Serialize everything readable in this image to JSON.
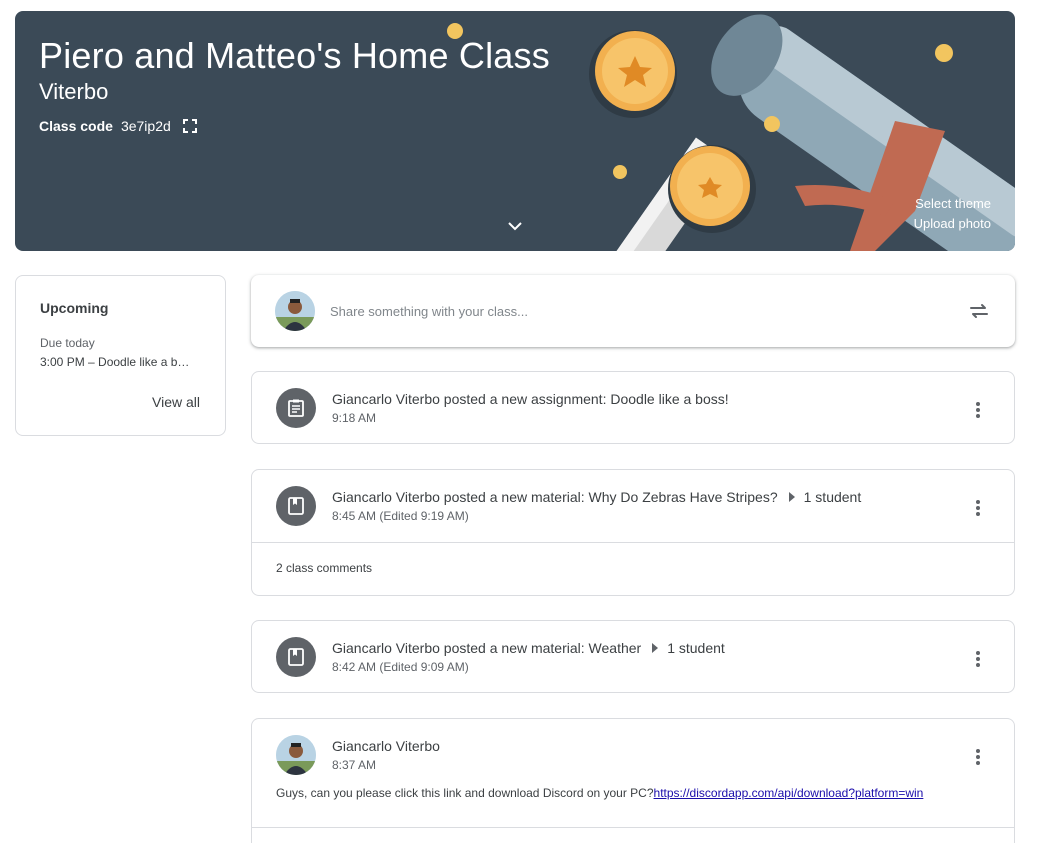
{
  "banner": {
    "title": "Piero and Matteo's Home Class",
    "subtitle": "Viterbo",
    "class_code_label": "Class code",
    "class_code": "3e7ip2d",
    "select_theme": "Select theme",
    "upload_photo": "Upload photo"
  },
  "upcoming": {
    "heading": "Upcoming",
    "due_label": "Due today",
    "item": "3:00 PM – Doodle like a b…",
    "view_all": "View all"
  },
  "share": {
    "placeholder": "Share something with your class..."
  },
  "posts": [
    {
      "title": "Giancarlo Viterbo posted a new assignment: Doodle like a boss!",
      "time": "9:18 AM"
    },
    {
      "title": "Giancarlo Viterbo posted a new material: Why Do Zebras Have Stripes?",
      "audience": "1 student",
      "time": "8:45 AM (Edited 9:19 AM)",
      "comments": "2 class comments"
    },
    {
      "title": "Giancarlo Viterbo posted a new material: Weather",
      "audience": "1 student",
      "time": "8:42 AM (Edited 9:09 AM)"
    },
    {
      "author": "Giancarlo Viterbo",
      "time": "8:37 AM",
      "text": "Guys, can you please click this link and download Discord on your PC?",
      "link": "https://discordapp.com/api/download?platform=win"
    }
  ],
  "colors": {
    "banner_bg": "#3b4a57",
    "icon_circle": "#5f6368",
    "link": "#1a0dab"
  }
}
